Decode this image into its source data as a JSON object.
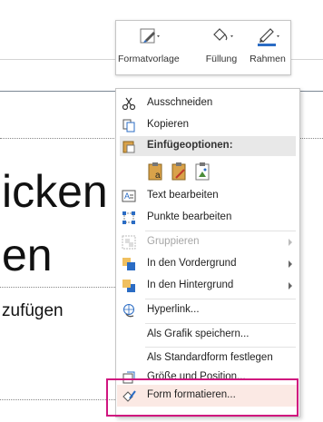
{
  "slide": {
    "line1": "icken",
    "line2": "en",
    "line3": "zufügen"
  },
  "toolbar": {
    "format_style_label": "Formatvorlage",
    "fill_label": "Füllung",
    "outline_label": "Rahmen"
  },
  "menu": {
    "cut": "Ausschneiden",
    "copy": "Kopieren",
    "paste_options": "Einfügeoptionen:",
    "edit_text": "Text bearbeiten",
    "edit_points": "Punkte bearbeiten",
    "group": "Gruppieren",
    "bring_to_front": "In den Vordergrund",
    "send_to_back": "In den Hintergrund",
    "hyperlink": "Hyperlink...",
    "save_as_picture": "Als Grafik speichern...",
    "set_default_shape": "Als Standardform festlegen",
    "size_position": "Größe und Position...",
    "format_shape": "Form formatieren..."
  },
  "colors": {
    "highlight_border": "#d0157f",
    "selected_bg": "#fbe9e4",
    "accent_blue": "#2b6cc4"
  }
}
